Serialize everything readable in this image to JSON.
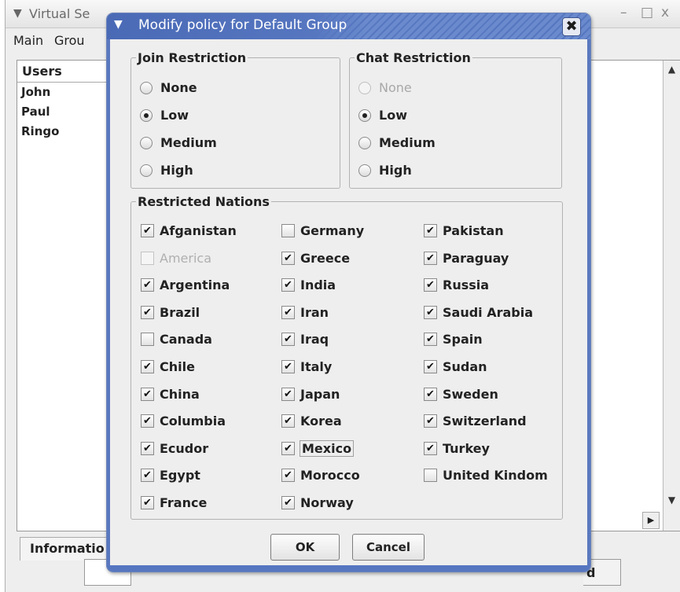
{
  "main_window": {
    "title": "Virtual Se... Dynamic Coalition Client (Asha)",
    "title_visible": "Virtual Se",
    "controls": {
      "minimize": "–",
      "maximize": "□",
      "close": "x"
    },
    "menu": [
      "Main",
      "Grou"
    ],
    "users": {
      "header": "Users",
      "items": [
        "John",
        "Paul",
        "Ringo"
      ]
    },
    "bottom_tab": "Informatio",
    "send_button_fragment": "d"
  },
  "dialog": {
    "title": "Modify policy for Default Group",
    "join_restriction": {
      "label": "Join Restriction",
      "options": [
        "None",
        "Low",
        "Medium",
        "High"
      ],
      "selected": "Low"
    },
    "chat_restriction": {
      "label": "Chat Restriction",
      "options": [
        "None",
        "Low",
        "Medium",
        "High"
      ],
      "selected": "Low",
      "disabled": [
        "None"
      ]
    },
    "restricted_nations": {
      "label": "Restricted Nations",
      "columns": [
        [
          {
            "name": "Afganistan",
            "checked": true
          },
          {
            "name": "America",
            "checked": false,
            "disabled": true
          },
          {
            "name": "Argentina",
            "checked": true
          },
          {
            "name": "Brazil",
            "checked": true
          },
          {
            "name": "Canada",
            "checked": false
          },
          {
            "name": "Chile",
            "checked": true
          },
          {
            "name": "China",
            "checked": true
          },
          {
            "name": "Columbia",
            "checked": true
          },
          {
            "name": "Ecudor",
            "checked": true
          },
          {
            "name": "Egypt",
            "checked": true
          },
          {
            "name": "France",
            "checked": true
          }
        ],
        [
          {
            "name": "Germany",
            "checked": false
          },
          {
            "name": "Greece",
            "checked": true
          },
          {
            "name": "India",
            "checked": true
          },
          {
            "name": "Iran",
            "checked": true
          },
          {
            "name": "Iraq",
            "checked": true
          },
          {
            "name": "Italy",
            "checked": true
          },
          {
            "name": "Japan",
            "checked": true
          },
          {
            "name": "Korea",
            "checked": true
          },
          {
            "name": "Mexico",
            "checked": true,
            "focused": true
          },
          {
            "name": "Morocco",
            "checked": true
          },
          {
            "name": "Norway",
            "checked": true
          }
        ],
        [
          {
            "name": "Pakistan",
            "checked": true
          },
          {
            "name": "Paraguay",
            "checked": true
          },
          {
            "name": "Russia",
            "checked": true
          },
          {
            "name": "Saudi Arabia",
            "checked": true
          },
          {
            "name": "Spain",
            "checked": true
          },
          {
            "name": "Sudan",
            "checked": true
          },
          {
            "name": "Sweden",
            "checked": true
          },
          {
            "name": "Switzerland",
            "checked": true
          },
          {
            "name": "Turkey",
            "checked": true
          },
          {
            "name": "United Kindom",
            "checked": false
          }
        ]
      ]
    },
    "buttons": {
      "ok": "OK",
      "cancel": "Cancel"
    },
    "icons": {
      "menu": "chevron-down-icon",
      "close": "close-icon",
      "check": "checkmark-icon"
    }
  }
}
